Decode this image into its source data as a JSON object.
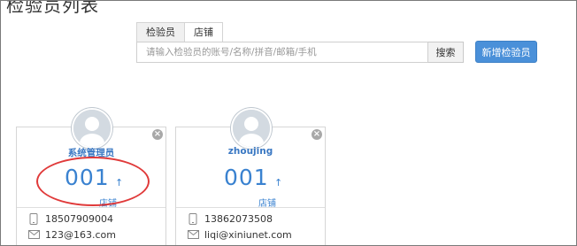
{
  "page": {
    "title": "检验员列表"
  },
  "tabs": [
    {
      "label": "检验员",
      "active": false
    },
    {
      "label": "店铺",
      "active": true
    }
  ],
  "search": {
    "placeholder": "请输入检验员的账号/名称/拼音/邮箱/手机",
    "value": "",
    "button_label": "搜索"
  },
  "add_button_label": "新增检验员",
  "colors": {
    "accent": "#4a90d9",
    "link_blue": "#3a82d0",
    "highlight_circle": "#e03a3a"
  },
  "inspectors": [
    {
      "name": "系统管理员",
      "count": "001",
      "trend_icon": "up-arrow-icon",
      "shop_label": "店铺",
      "phone": "18507909004",
      "email": "123@163.com",
      "highlighted": true
    },
    {
      "name": "zhoujing",
      "count": "001",
      "trend_icon": "up-arrow-icon",
      "shop_label": "店铺",
      "phone": "13862073508",
      "email": "liqi@xiniunet.com",
      "highlighted": false
    }
  ]
}
